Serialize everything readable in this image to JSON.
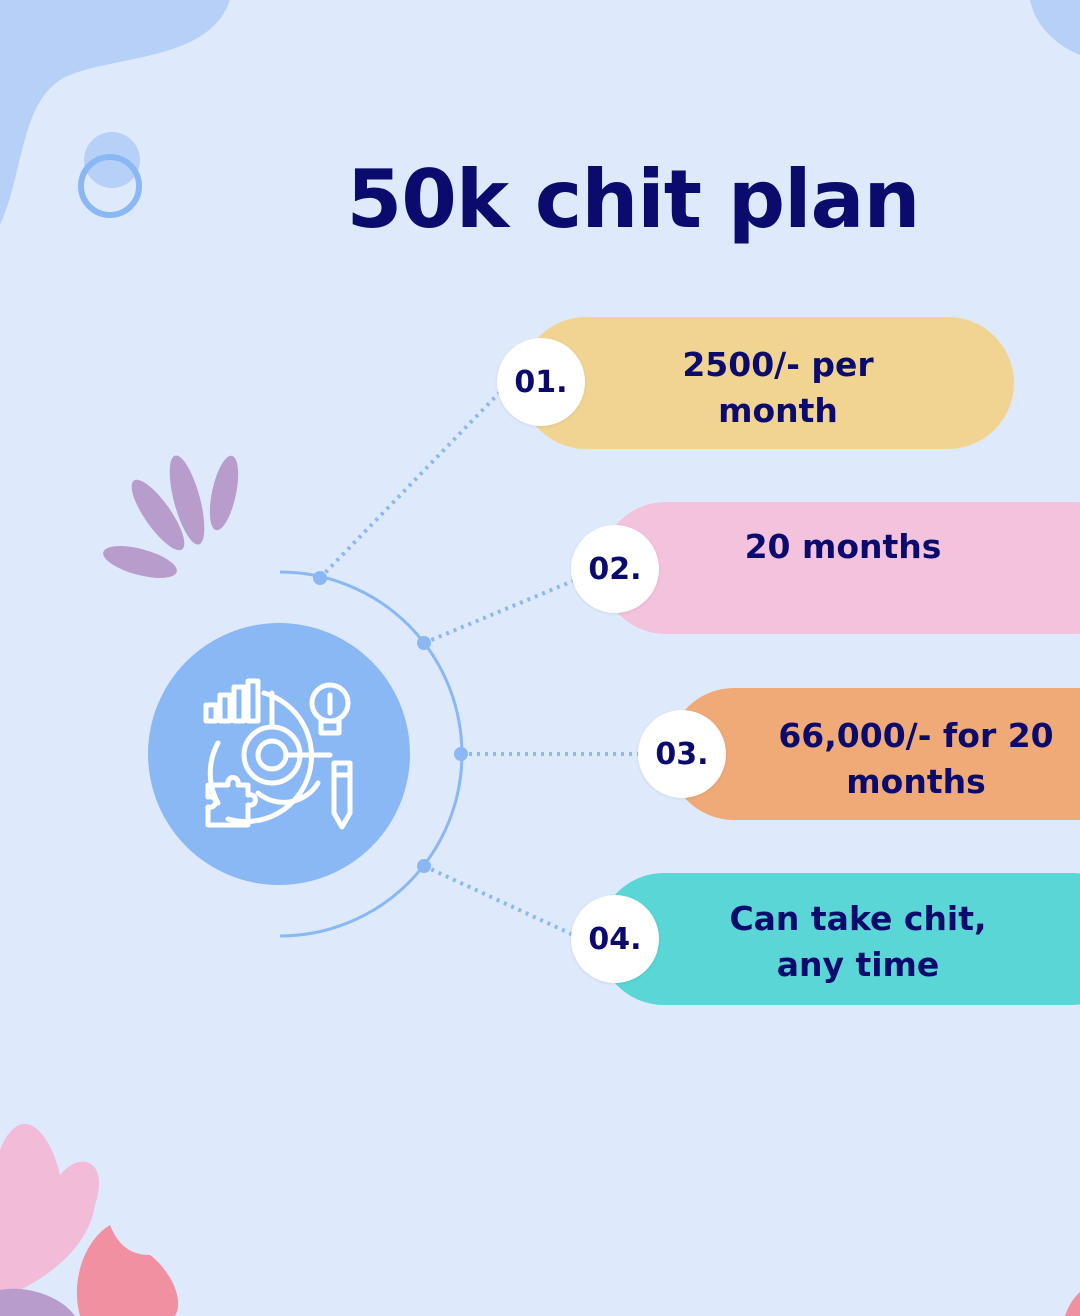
{
  "title": "50k chit plan",
  "colors": {
    "background": "#deeafb",
    "title": "#0b0b6e",
    "hub": "#8ab8f5",
    "step1": "#f1d492",
    "step2": "#f3c2dc",
    "step3": "#f0aa78",
    "step4": "#5ad6d6"
  },
  "hub_icon": "strategy-planning-icon",
  "steps": [
    {
      "number": "01.",
      "line1": "2500/- per",
      "line2": "month"
    },
    {
      "number": "02.",
      "line1": "20 months",
      "line2": ""
    },
    {
      "number": "03.",
      "line1": "66,000/- for 20",
      "line2": "months"
    },
    {
      "number": "04.",
      "line1": "Can take chit,",
      "line2": "any time"
    }
  ]
}
